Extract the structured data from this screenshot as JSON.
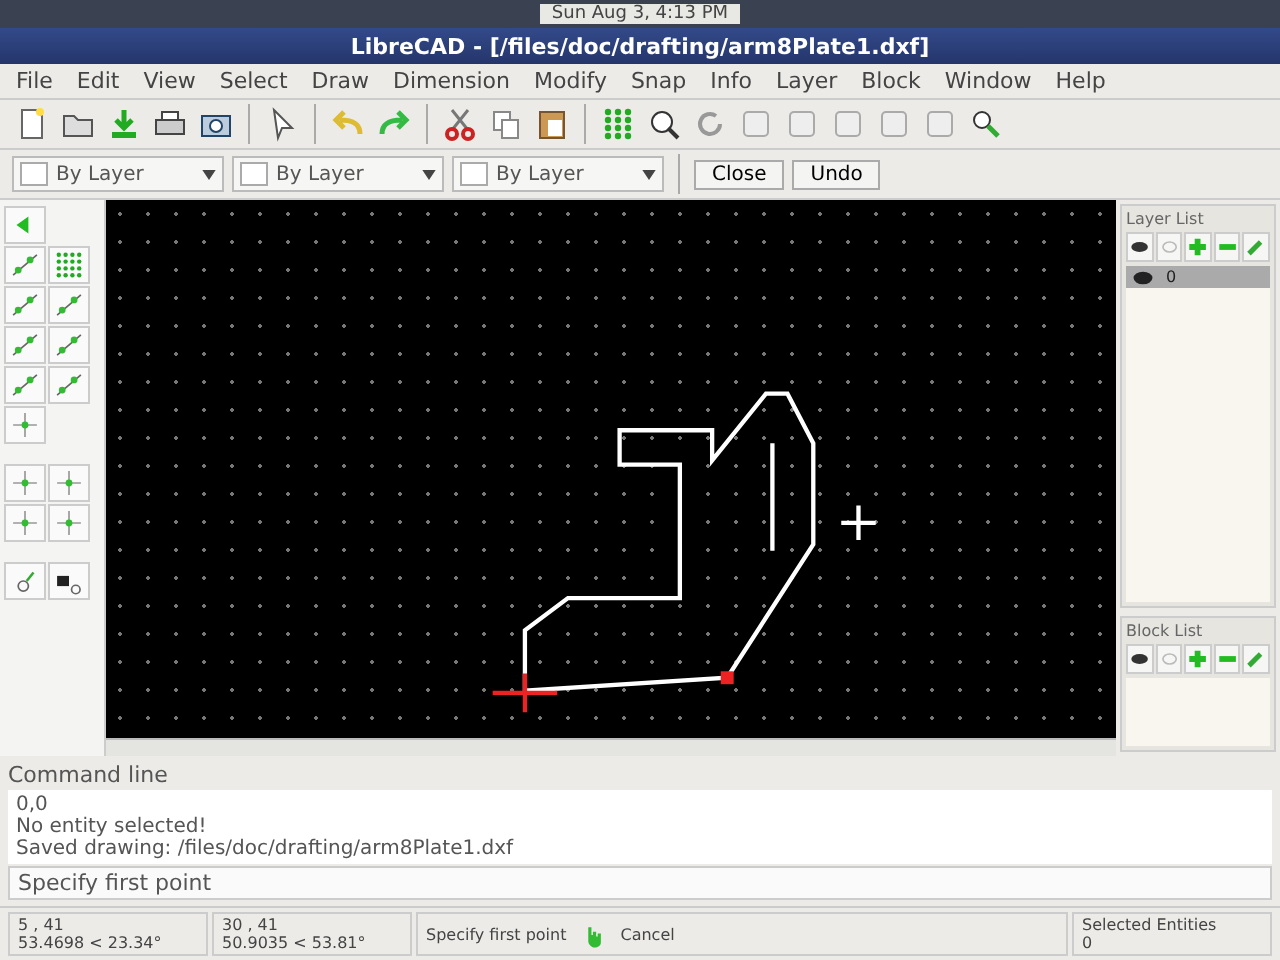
{
  "top_panel": {
    "clock": "Sun Aug 3, 4:13 PM"
  },
  "window": {
    "title": "LibreCAD - [/files/doc/drafting/arm8Plate1.dxf]"
  },
  "menu": [
    "File",
    "Edit",
    "View",
    "Select",
    "Draw",
    "Dimension",
    "Modify",
    "Snap",
    "Info",
    "Layer",
    "Block",
    "Window",
    "Help"
  ],
  "property_bar": {
    "dropdowns": [
      "By Layer",
      "By Layer",
      "By Layer"
    ],
    "buttons": [
      "Close",
      "Undo"
    ]
  },
  "layer_list": {
    "title": "Layer List",
    "layers": [
      {
        "name": "0",
        "visible": true,
        "selected": true
      }
    ]
  },
  "block_list": {
    "title": "Block List"
  },
  "command_line": {
    "title": "Command line",
    "history": [
      "0,0",
      "No entity selected!",
      "Saved drawing: /files/doc/drafting/arm8Plate1.dxf"
    ],
    "prompt": "Specify first point"
  },
  "status_bar": {
    "absolute_coords": "5 , 41",
    "absolute_polar": "53.4698 < 23.34°",
    "relative_coords": "30 , 41",
    "relative_polar": "50.9035 < 53.81°",
    "mouse_hint": "Specify first point",
    "right_hint": "Cancel",
    "selected_label": "Selected Entities",
    "selected_count": "0"
  }
}
